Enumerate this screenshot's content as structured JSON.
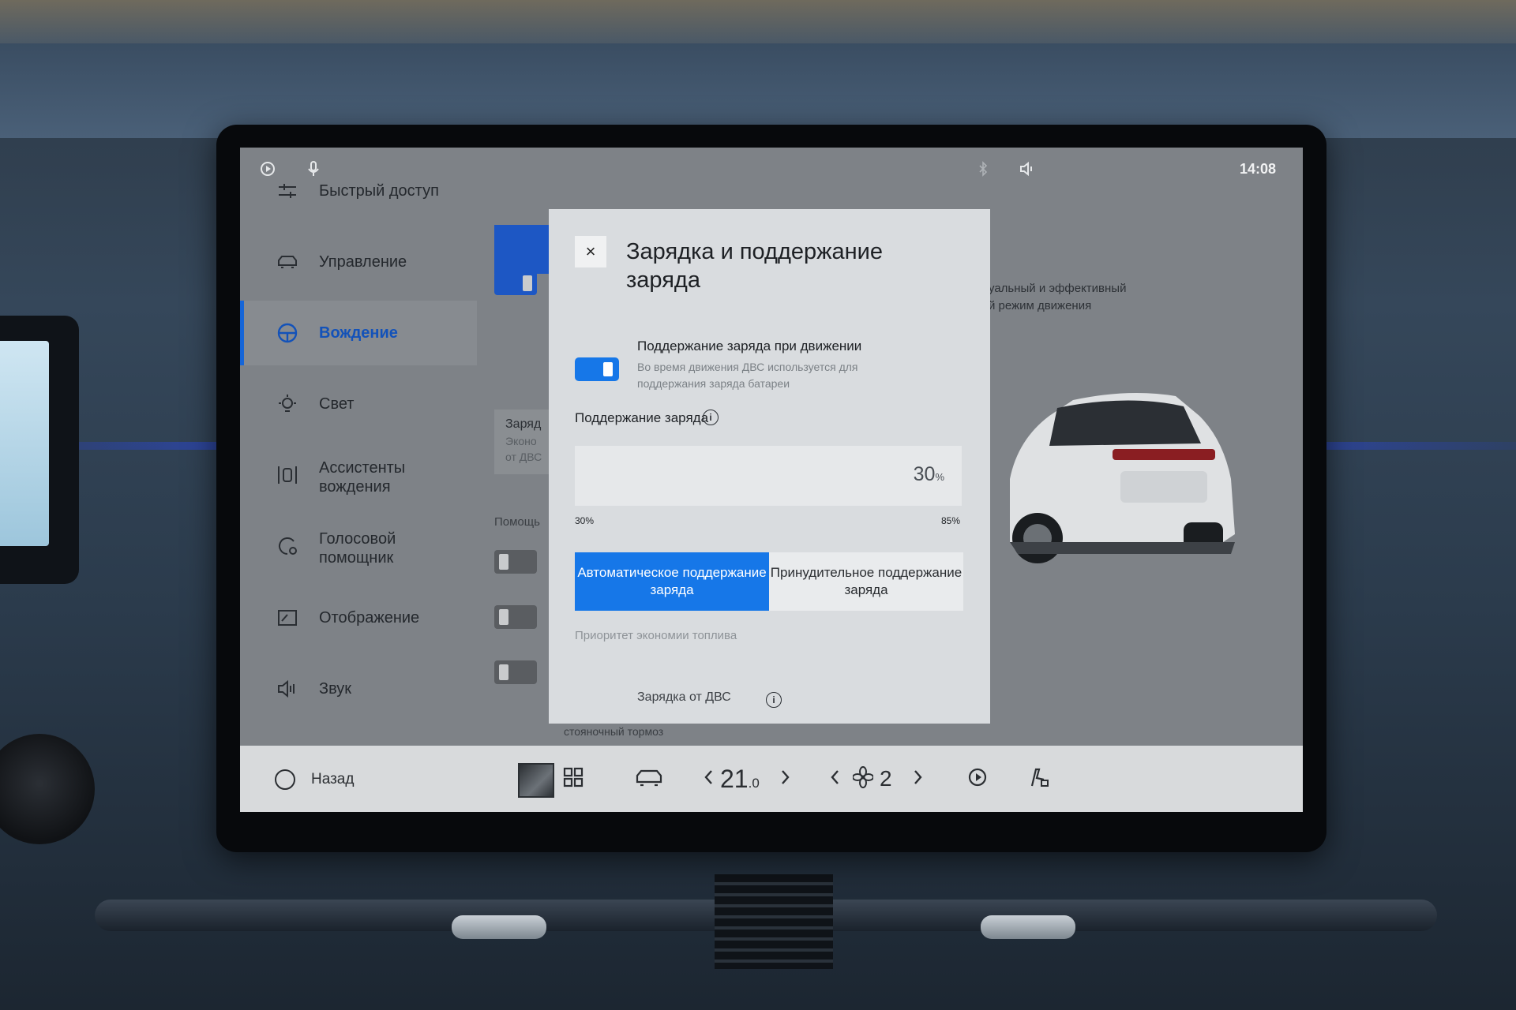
{
  "status_bar": {
    "time": "14:08",
    "icons": [
      "carplay-icon",
      "microphone-icon",
      "bluetooth-icon",
      "volume-icon"
    ]
  },
  "sidebar": {
    "items": [
      {
        "label": "Быстрый доступ",
        "icon": "quick-access-icon"
      },
      {
        "label": "Управление",
        "icon": "car-control-icon"
      },
      {
        "label": "Вождение",
        "icon": "steering-wheel-icon",
        "active": true
      },
      {
        "label": "Свет",
        "icon": "light-bulb-icon"
      },
      {
        "label": "Ассистенты вождения",
        "icon": "driving-assist-icon"
      },
      {
        "label": "Голосовой помощник",
        "icon": "voice-assistant-icon"
      },
      {
        "label": "Отображение",
        "icon": "display-icon"
      },
      {
        "label": "Звук",
        "icon": "speaker-icon"
      }
    ]
  },
  "background": {
    "card_title": "Заряд",
    "card_line1": "Эконо",
    "card_line2": "от ДВС",
    "section_label": "Помощь",
    "right_text_line1": "уальный и эффективный",
    "right_text_line2": "й режим движения",
    "below_text": "стояночный тормоз"
  },
  "modal": {
    "title": "Зарядка и поддержание заряда",
    "close_label": "×",
    "option": {
      "title": "Поддержание заряда при движении",
      "description": "Во время движения ДВС используется для поддержания заряда батареи",
      "enabled": true
    },
    "charge_section": {
      "label": "Поддержание заряда",
      "info_label": "i",
      "value": 30,
      "value_text": "30",
      "unit": "%",
      "min_label": "30%",
      "max_label": "85%"
    },
    "modes": {
      "auto": "Автоматическое поддержание заряда",
      "forced": "Принудительное поддержание заряда",
      "selected": "auto"
    },
    "hint": "Приоритет экономии топлива",
    "cut_item": "Зарядка от ДВС"
  },
  "dock": {
    "back_label": "Назад",
    "temperature_int": "21",
    "temperature_dec": ".0",
    "fan_level": "2"
  },
  "colors": {
    "accent": "#1677e8",
    "active_sidebar": "#1352b9"
  }
}
